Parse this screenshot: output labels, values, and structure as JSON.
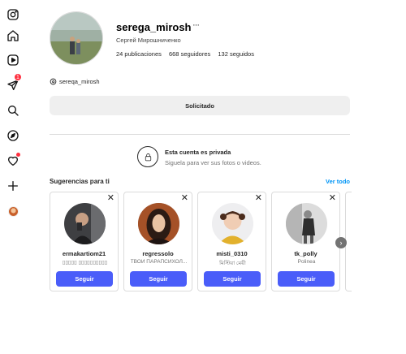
{
  "nav": {
    "items": [
      "instagram-icon",
      "home-icon",
      "reels-icon",
      "messages-icon",
      "search-icon",
      "explore-icon",
      "notifications-icon",
      "create-icon",
      "profile-avatar"
    ],
    "messages_badge": "1"
  },
  "profile": {
    "username": "serega_mirosh",
    "more": "···",
    "full_name": "Сергей Мирошниченко",
    "posts": "24 publicaciones",
    "followers": "668 seguidores",
    "following": "132 seguidos",
    "threads_handle": "sereqa_mirosh",
    "requested_label": "Solicitado"
  },
  "private": {
    "title": "Esta cuenta es privada",
    "subtitle": "Siguela para ver sus fotos o videos."
  },
  "suggestions": {
    "title": "Sugerencias para ti",
    "see_all": "Ver todo",
    "close": "✕",
    "follow_label": "Seguir",
    "next": "›",
    "cards": [
      {
        "username": "ermakartiom21",
        "subtitle": "▯▯▯▯▯ ▯▯▯▯▯▯▯▯▯▯"
      },
      {
        "username": "regressolo",
        "subtitle": "ТВОЙ ПАРАПСИХОЛ..."
      },
      {
        "username": "misti_0310",
        "subtitle": "মিস্টিয়া মেয়ী"
      },
      {
        "username": "tk_polly",
        "subtitle": "Polinea"
      }
    ]
  },
  "colors": {
    "follow_button": "#4a5df9",
    "link": "#0095f6",
    "badge": "#ff3040",
    "requested_bg": "#efefef"
  }
}
